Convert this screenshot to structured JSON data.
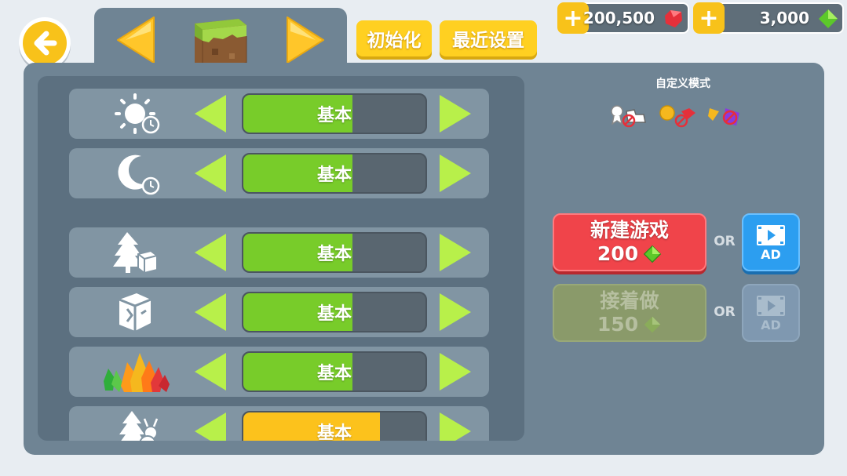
{
  "header": {
    "reset_label": "初始化",
    "recent_label": "最近设置"
  },
  "currency": {
    "red_gems": "200,500",
    "green_gems": "3,000",
    "plus": "+"
  },
  "settings_rows": [
    {
      "icon": "sun-clock-icon",
      "value": "基本",
      "fill": 0.6,
      "color": "#78cc2a"
    },
    {
      "icon": "moon-clock-icon",
      "value": "基本",
      "fill": 0.6,
      "color": "#78cc2a"
    },
    {
      "icon": "tree-block-icon",
      "value": "基本",
      "fill": 0.6,
      "color": "#78cc2a"
    },
    {
      "icon": "broken-block-icon",
      "value": "基本",
      "fill": 0.6,
      "color": "#78cc2a"
    },
    {
      "icon": "crystals-icon",
      "value": "基本",
      "fill": 0.6,
      "color": "#78cc2a"
    },
    {
      "icon": "tree-ant-icon",
      "value": "基本",
      "fill": 0.75,
      "color": "#fcc21c"
    }
  ],
  "right": {
    "mode_title": "自定义模式",
    "new_game_label": "新建游戏",
    "new_game_cost": "200",
    "continue_label": "接着做",
    "continue_cost": "150",
    "or_label": "OR",
    "ad_label": "AD"
  },
  "colors": {
    "accent_yellow": "#f8c21a",
    "arrow_green": "#b8f04a",
    "new_game_red": "#f0444a",
    "ad_blue": "#2c9ef0"
  }
}
